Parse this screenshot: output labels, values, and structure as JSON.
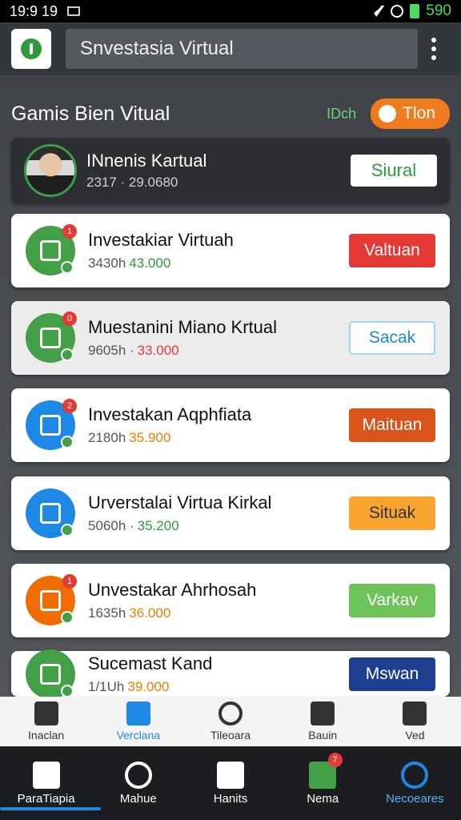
{
  "status_bar": {
    "time": "19:9 19",
    "battery": "590"
  },
  "app_bar": {
    "search_text": "Snvestasia Virtual"
  },
  "section": {
    "title": "Gamis Bien Vitual",
    "hint": "IDch",
    "action_label": "Tlon"
  },
  "profile": {
    "name": "INnenis Kartual",
    "meta": "2317 · 29.0680",
    "button": "Siural",
    "button_color": "#2e9b3a"
  },
  "items": [
    {
      "title": "Investakiar Virtuah",
      "meta": "3430h",
      "value": "43.000",
      "value_color": "#2e9b3a",
      "button": "Valtuan",
      "button_color": "#e53935",
      "icon_color": "#43a047",
      "badge": "1",
      "icon": "calendar-icon"
    },
    {
      "title": "Muestanini Miano Krtual",
      "meta": "9605h ·",
      "value": "33.000",
      "value_color": "#e53935",
      "button": "Sacak",
      "button_color": "#ffffff",
      "icon_color": "#43a047",
      "badge": "0",
      "icon": "sphere-icon"
    },
    {
      "title": "Investakan Aqphfiata",
      "meta": "2180h",
      "value": "35.900",
      "value_color": "#ef7d00",
      "button": "Maituan",
      "button_color": "#d9541b",
      "icon_color": "#1e88e5",
      "badge": "2",
      "icon": "gear-icon"
    },
    {
      "title": "Urverstalai Virtua Kirkal",
      "meta": "5060h ·",
      "value": "35.200",
      "value_color": "#2e9b3a",
      "button": "Situak",
      "button_color": "#f7a52f",
      "icon_color": "#1e88e5",
      "badge": "",
      "icon": "calendar-icon"
    },
    {
      "title": "Unvestakar Ahrhosah",
      "meta": "1635h",
      "value": "36.000",
      "value_color": "#ef7d00",
      "button": "Varkav",
      "button_color": "#6dc25a",
      "icon_color": "#ef6c00",
      "badge": "1",
      "icon": "calendar-icon"
    },
    {
      "title": "Sucemast Kand",
      "meta": "1/1Uh",
      "value": "39.000",
      "value_color": "#ef7d00",
      "button": "Mswan",
      "button_color": "#1e3f8f",
      "icon_color": "#43a047",
      "badge": "",
      "icon": "leaf-icon"
    }
  ],
  "nav_top": [
    {
      "label": "Inaclan",
      "icon": "home-icon"
    },
    {
      "label": "Verclana",
      "icon": "document-icon"
    },
    {
      "label": "Tileoara",
      "icon": "search-icon"
    },
    {
      "label": "Bauin",
      "icon": "location-icon"
    },
    {
      "label": "Ved",
      "icon": "chart-icon"
    }
  ],
  "nav_bottom": [
    {
      "label": "ParaTiapia",
      "icon": "home-icon"
    },
    {
      "label": "Mahue",
      "icon": "search-icon"
    },
    {
      "label": "Hanits",
      "icon": "grid-icon"
    },
    {
      "label": "Nema",
      "icon": "chart-icon",
      "badge": "7"
    },
    {
      "label": "Necoeares",
      "icon": "search-icon"
    }
  ]
}
